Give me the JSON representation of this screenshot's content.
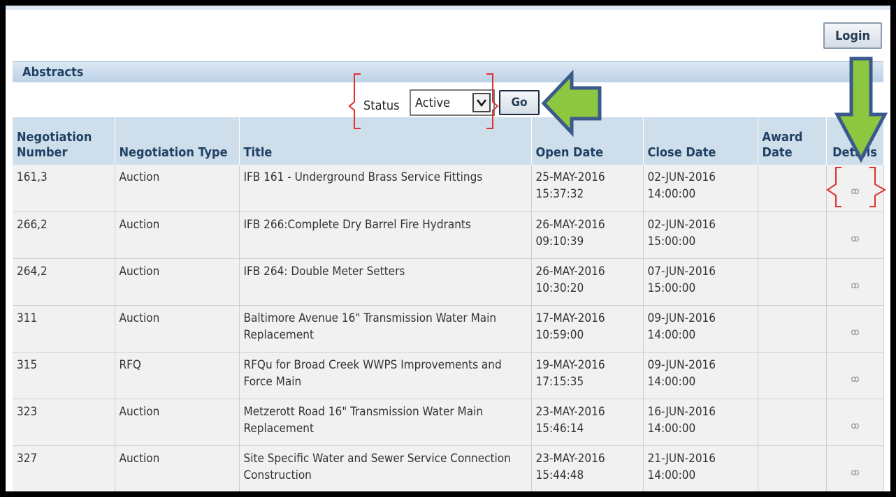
{
  "header": {
    "login_label": "Login"
  },
  "section": {
    "title": "Abstracts"
  },
  "filter": {
    "status_label": "Status",
    "status_value": "Active",
    "go_label": "Go"
  },
  "table": {
    "columns": [
      "Negotiation Number",
      "Negotiation Type",
      "Title",
      "Open Date",
      "Close Date",
      "Award Date",
      "Details"
    ],
    "rows": [
      {
        "number": "161,3",
        "type": "Auction",
        "title": "IFB 161 - Underground Brass Service Fittings",
        "open_date": "25-MAY-2016",
        "open_time": "15:37:32",
        "close_date": "02-JUN-2016",
        "close_time": "14:00:00",
        "award_date": ""
      },
      {
        "number": "266,2",
        "type": "Auction",
        "title": "IFB 266:Complete Dry Barrel Fire Hydrants",
        "open_date": "26-MAY-2016",
        "open_time": "09:10:39",
        "close_date": "02-JUN-2016",
        "close_time": "15:00:00",
        "award_date": ""
      },
      {
        "number": "264,2",
        "type": "Auction",
        "title": "IFB 264: Double Meter Setters",
        "open_date": "26-MAY-2016",
        "open_time": "10:30:20",
        "close_date": "07-JUN-2016",
        "close_time": "15:00:00",
        "award_date": ""
      },
      {
        "number": "311",
        "type": "Auction",
        "title": "Baltimore Avenue 16\" Transmission Water Main Replacement",
        "open_date": "17-MAY-2016",
        "open_time": "10:59:00",
        "close_date": "09-JUN-2016",
        "close_time": "14:00:00",
        "award_date": ""
      },
      {
        "number": "315",
        "type": "RFQ",
        "title": "RFQu for Broad Creek WWPS Improvements and Force Main",
        "open_date": "19-MAY-2016",
        "open_time": "17:15:35",
        "close_date": "09-JUN-2016",
        "close_time": "14:00:00",
        "award_date": ""
      },
      {
        "number": "323",
        "type": "Auction",
        "title": "Metzerott Road 16\" Transmission Water Main Replacement",
        "open_date": "23-MAY-2016",
        "open_time": "15:46:14",
        "close_date": "16-JUN-2016",
        "close_time": "14:00:00",
        "award_date": ""
      },
      {
        "number": "327",
        "type": "Auction",
        "title": "Site Specific Water and Sewer Service Connection Construction",
        "open_date": "23-MAY-2016",
        "open_time": "15:44:48",
        "close_date": "21-JUN-2016",
        "close_time": "14:00:00",
        "award_date": ""
      }
    ]
  },
  "icons": {
    "details": "glasses-icon",
    "dropdown": "chevron-down-icon",
    "callout_arrows": "green-arrow-icon"
  },
  "colors": {
    "header_bg": "#cfdeeb",
    "header_text": "#1f4164",
    "row_bg": "#f1f1f1",
    "arrow_fill": "#8dc63f",
    "arrow_stroke": "#3a5a8c",
    "bracket": "#e03030"
  }
}
